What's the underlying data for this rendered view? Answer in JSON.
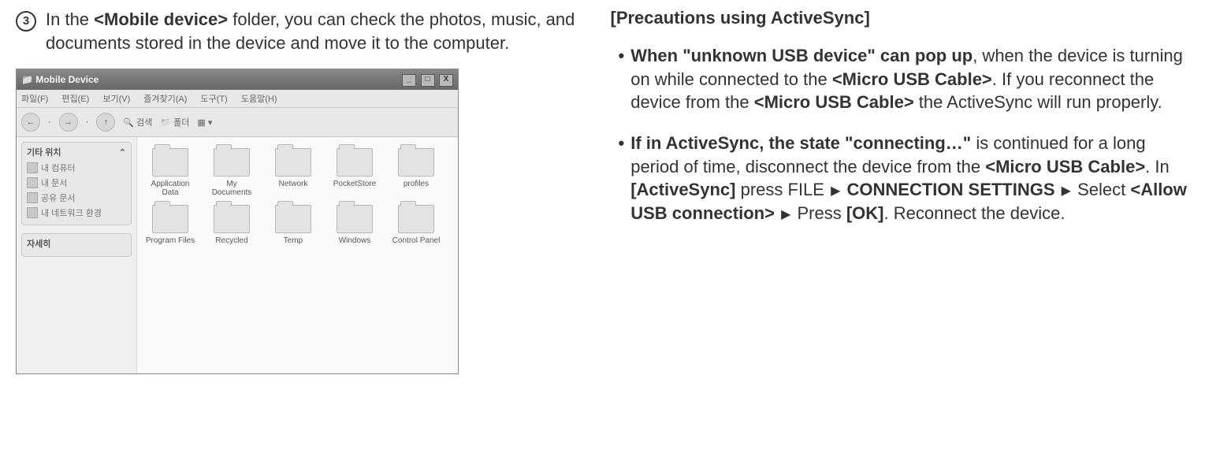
{
  "left": {
    "step_number": "3",
    "text_parts": {
      "t1": "In the ",
      "b1": "<Mobile device>",
      "t2": " folder, you can check the photos, music, and documents stored in the device and move it to the computer."
    }
  },
  "explorer": {
    "title": "Mobile Device",
    "win_btns": [
      "_",
      "□",
      "X"
    ],
    "menu": [
      "파일(F)",
      "편집(E)",
      "보기(V)",
      "즐겨찾기(A)",
      "도구(T)",
      "도움말(H)"
    ],
    "toolbar": {
      "search": "검색",
      "folders": "폴더"
    },
    "side_panel1": {
      "title": "기타 위치",
      "items": [
        "내 컴퓨터",
        "내 문서",
        "공유 문서",
        "내 네트워크 환경"
      ]
    },
    "side_panel2": {
      "title": "자세히"
    },
    "icons": [
      "Application Data",
      "My Documents",
      "Network",
      "PocketStore",
      "profiles",
      "Program Files",
      "Recycled",
      "Temp",
      "Windows",
      "Control Panel"
    ]
  },
  "right": {
    "heading": "[Precautions using ActiveSync]",
    "bullet1": {
      "b1": "When \"unknown USB device\" can pop up",
      "t1": ", when the device is turning on while connected to the ",
      "b2": "<Micro USB Cable>",
      "t2": ". If you reconnect the device from the ",
      "b3": "<Micro USB Cable>",
      "t3": " the ActiveSync will run properly."
    },
    "bullet2": {
      "b1": "If in ActiveSync, the state \"connecting…\"",
      "t1": " is continued for a long period of time, disconnect the device from the ",
      "b2": "<Micro USB Cable>",
      "t2": ". In ",
      "b3": "[ActiveSync]",
      "t3": " press FILE ",
      "b4": "CONNECTION SETTINGS",
      "t4": " Select ",
      "b5": "<Allow USB connection>",
      "t5": " Press ",
      "b6": "[OK]",
      "t6": ". Reconnect the device."
    }
  }
}
